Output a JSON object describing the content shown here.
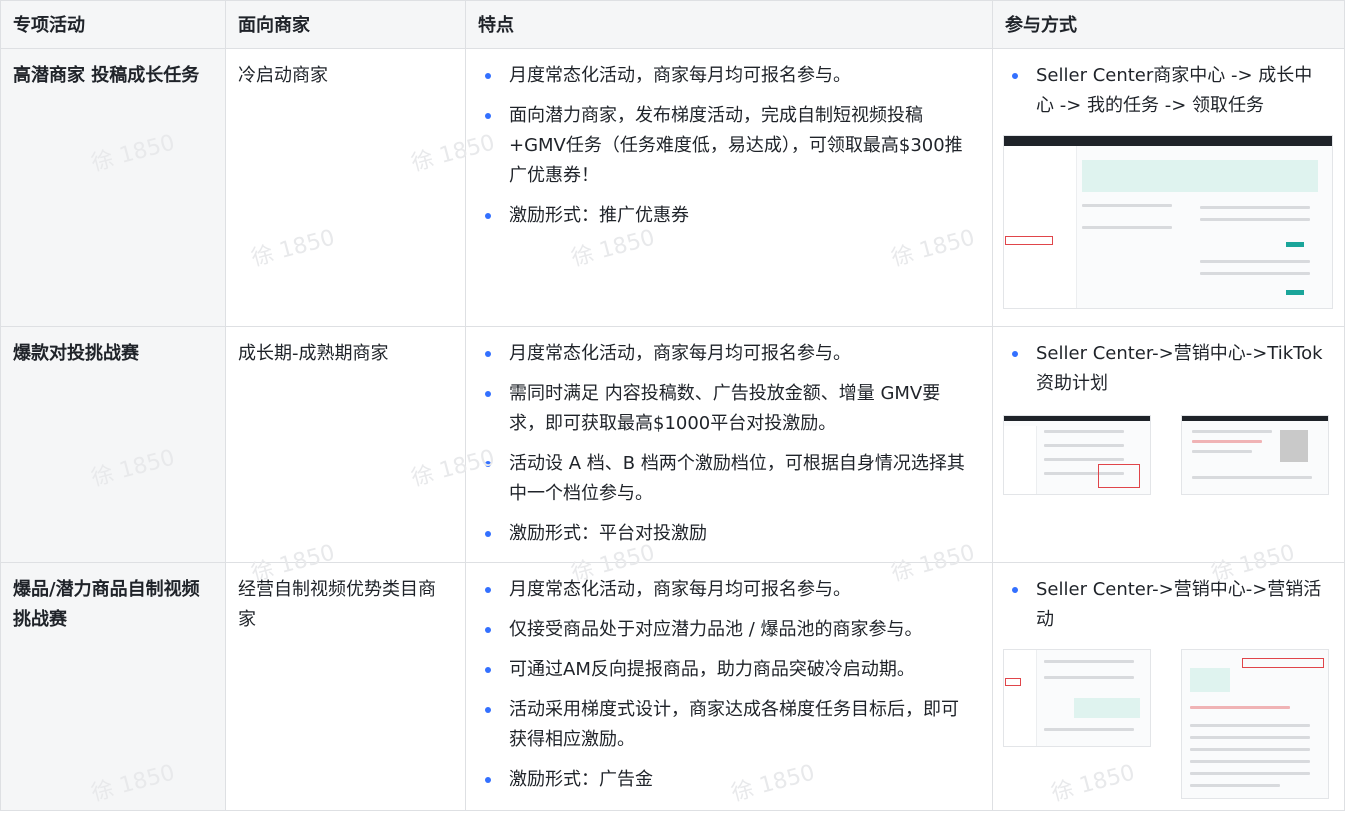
{
  "headers": {
    "activity": "专项活动",
    "merchant": "面向商家",
    "features": "特点",
    "method": "参与方式"
  },
  "rows": [
    {
      "activity": "高潜商家 投稿成长任务",
      "merchant": "冷启动商家",
      "features": [
        "月度常态化活动，商家每月均可报名参与。",
        "面向潜力商家，发布梯度活动，完成自制短视频投稿+GMV任务（任务难度低，易达成），可领取最高$300推广优惠券！",
        "激励形式：推广优惠券"
      ],
      "method": [
        "Seller Center商家中心 -> 成长中心 -> 我的任务 -> 领取任务"
      ]
    },
    {
      "activity": "爆款对投挑战赛",
      "merchant": "成长期-成熟期商家",
      "features": [
        "月度常态化活动，商家每月均可报名参与。",
        "需同时满足 内容投稿数、广告投放金额、增量 GMV要求，即可获取最高$1000平台对投激励。",
        "活动设 A 档、B 档两个激励档位，可根据自身情况选择其中一个档位参与。",
        "激励形式：平台对投激励"
      ],
      "method": [
        "Seller Center->营销中心->TikTok资助计划"
      ]
    },
    {
      "activity": "爆品/潜力商品自制视频挑战赛",
      "merchant": "经营自制视频优势类目商家",
      "features": [
        "月度常态化活动，商家每月均可报名参与。",
        "仅接受商品处于对应潜力品池 / 爆品池的商家参与。",
        "可通过AM反向提报商品，助力商品突破冷启动期。",
        "活动采用梯度式设计，商家达成各梯度任务目标后，即可获得相应激励。",
        "激励形式：广告金"
      ],
      "method": [
        "Seller Center->营销中心->营销活动"
      ]
    }
  ],
  "watermark": "徐 1850",
  "colors": {
    "bullet": "#3370ff",
    "header_bg": "#f5f6f7",
    "border": "#dee0e3"
  }
}
